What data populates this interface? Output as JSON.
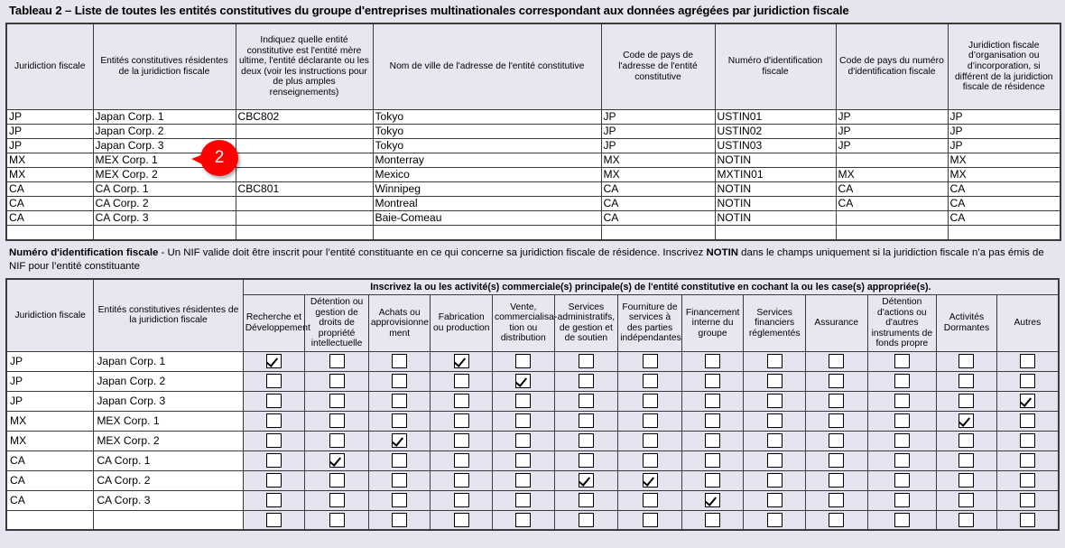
{
  "title": "Tableau 2 – Liste de toutes les entités constitutives du groupe d'entreprises multinationales correspondant aux données agrégées par juridiction fiscale",
  "callout": {
    "label": "2",
    "color": "#ff0000"
  },
  "table1": {
    "headers": [
      "Juridiction fiscale",
      "Entités constitutives résidentes de la juridiction fiscale",
      "Indiquez quelle entité constitutive est l'entité mère ultime, l'entité déclarante ou les deux (voir les instructions pour de plus amples renseignements)",
      "Nom de ville de l'adresse de l'entité constitutive",
      "Code de pays de l'adresse de l'entité constitutive",
      "Numéro d'identification fiscale",
      "Code de pays du numéro d'identification fiscale",
      "Juridiction fiscale d’organisation ou d’incorporation, si différent de la juridiction fiscale de résidence"
    ],
    "rows": [
      [
        "JP",
        "Japan Corp. 1",
        "CBC802",
        "Tokyo",
        "JP",
        "USTIN01",
        "JP",
        "JP"
      ],
      [
        "JP",
        "Japan Corp. 2",
        "",
        "Tokyo",
        "JP",
        "USTIN02",
        "JP",
        "JP"
      ],
      [
        "JP",
        "Japan Corp. 3",
        "",
        "Tokyo",
        "JP",
        "USTIN03",
        "JP",
        "JP"
      ],
      [
        "MX",
        "MEX Corp. 1",
        "",
        "Monterray",
        "MX",
        "NOTIN",
        "",
        "MX"
      ],
      [
        "MX",
        "MEX Corp. 2",
        "",
        "Mexico",
        "MX",
        "MXTIN01",
        "MX",
        "MX"
      ],
      [
        "CA",
        "CA Corp. 1",
        "CBC801",
        "Winnipeg",
        "CA",
        "NOTIN",
        "CA",
        "CA"
      ],
      [
        "CA",
        "CA Corp. 2",
        "",
        "Montreal",
        "CA",
        "NOTIN",
        "CA",
        "CA"
      ],
      [
        "CA",
        "CA Corp. 3",
        "",
        "Baie-Comeau",
        "CA",
        "NOTIN",
        "",
        "CA"
      ],
      [
        "",
        "",
        "",
        "",
        "",
        "",
        "",
        ""
      ]
    ]
  },
  "note": {
    "bold_lead": "Numéro d'identification fiscale",
    "text_1": " - Un NIF valide doit être inscrit pour l’entité constituante en ce qui concerne sa juridiction fiscale de résidence. Inscrivez ",
    "bold_mid": "NOTIN",
    "text_2": " dans le champs uniquement si la juridiction fiscale n’a pas émis de NIF pour l’entité constituante"
  },
  "table2": {
    "section_header": "Inscrivez la ou les activité(s) commerciale(s) principale(s) de l'entité constitutive en cochant la ou les case(s) appropriée(s).",
    "headers": [
      "Juridiction fiscale",
      "Entités constitutives résidentes de la juridiction fiscale"
    ],
    "activity_headers": [
      "Recherche et Développement",
      "Détention ou gestion de droits de propriété intellectuelle",
      "Achats ou approvisionne ment",
      "Fabrication ou production",
      "Vente, commercialisa-tion ou distribution",
      "Services administratifs, de gestion et de soutien",
      "Fourniture de services à des parties indépendantes",
      "Financement interne du groupe",
      "Services financiers réglementés",
      "Assurance",
      "Détention d'actions ou d'autres instruments de fonds propre",
      "Activités Dormantes",
      "Autres"
    ],
    "rows": [
      {
        "jurisdiction": "JP",
        "entity": "Japan Corp. 1",
        "checks": [
          true,
          false,
          false,
          true,
          false,
          false,
          false,
          false,
          false,
          false,
          false,
          false,
          false
        ]
      },
      {
        "jurisdiction": "JP",
        "entity": "Japan Corp. 2",
        "checks": [
          false,
          false,
          false,
          false,
          true,
          false,
          false,
          false,
          false,
          false,
          false,
          false,
          false
        ]
      },
      {
        "jurisdiction": "JP",
        "entity": "Japan Corp. 3",
        "checks": [
          false,
          false,
          false,
          false,
          false,
          false,
          false,
          false,
          false,
          false,
          false,
          false,
          true
        ]
      },
      {
        "jurisdiction": "MX",
        "entity": "MEX Corp. 1",
        "checks": [
          false,
          false,
          false,
          false,
          false,
          false,
          false,
          false,
          false,
          false,
          false,
          true,
          false
        ]
      },
      {
        "jurisdiction": "MX",
        "entity": "MEX Corp. 2",
        "checks": [
          false,
          false,
          true,
          false,
          false,
          false,
          false,
          false,
          false,
          false,
          false,
          false,
          false
        ]
      },
      {
        "jurisdiction": "CA",
        "entity": "CA Corp. 1",
        "checks": [
          false,
          true,
          false,
          false,
          false,
          false,
          false,
          false,
          false,
          false,
          false,
          false,
          false
        ]
      },
      {
        "jurisdiction": "CA",
        "entity": "CA Corp. 2",
        "checks": [
          false,
          false,
          false,
          false,
          false,
          true,
          true,
          false,
          false,
          false,
          false,
          false,
          false
        ]
      },
      {
        "jurisdiction": "CA",
        "entity": "CA Corp. 3",
        "checks": [
          false,
          false,
          false,
          false,
          false,
          false,
          false,
          true,
          false,
          false,
          false,
          false,
          false
        ]
      },
      {
        "jurisdiction": "",
        "entity": "",
        "checks": [
          false,
          false,
          false,
          false,
          false,
          false,
          false,
          false,
          false,
          false,
          false,
          false,
          false
        ]
      }
    ]
  }
}
